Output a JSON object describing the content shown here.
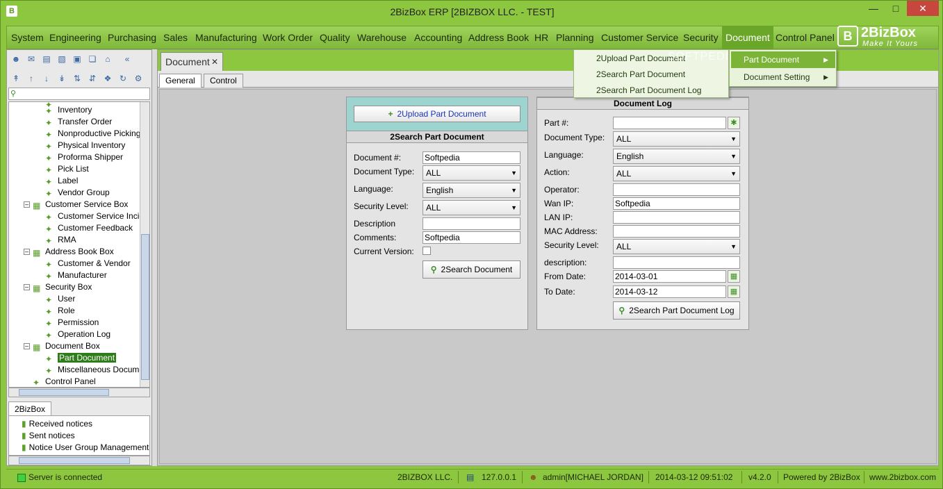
{
  "app": {
    "title": "2BizBox ERP [2BIZBOX LLC. - TEST]",
    "icon_label": "B",
    "minimize": "—",
    "maximize": "□",
    "close": "✕"
  },
  "menu": {
    "items": [
      "System",
      "Engineering",
      "Purchasing",
      "Sales",
      "Manufacturing",
      "Work Order",
      "Quality",
      "Warehouse",
      "Accounting",
      "Address Book",
      "HR",
      "Planning",
      "Customer Service",
      "Security",
      "Document",
      "Control Panel"
    ],
    "active": "Document"
  },
  "logo": {
    "name": "2BizBox",
    "tagline": "Make It Yours",
    "mark": "B"
  },
  "watermark": "SOFTPEDIA",
  "document_menu": {
    "items": [
      "Part Document",
      "Document Setting"
    ],
    "highlighted": "Part Document"
  },
  "part_document_submenu": {
    "items": [
      "2Upload Part Document",
      "2Search Part Document",
      "2Search Part Document Log"
    ]
  },
  "left_panel": {
    "search_placeholder": "",
    "tree": [
      {
        "label": "Inventory",
        "level": 2
      },
      {
        "label": "Transfer Order",
        "level": 2
      },
      {
        "label": "Nonproductive Picking",
        "level": 2
      },
      {
        "label": "Physical Inventory",
        "level": 2
      },
      {
        "label": "Proforma Shipper",
        "level": 2
      },
      {
        "label": "Pick List",
        "level": 2
      },
      {
        "label": "Label",
        "level": 2
      },
      {
        "label": "Vendor Group",
        "level": 2
      },
      {
        "label": "Customer Service Box",
        "level": 1
      },
      {
        "label": "Customer Service Incident",
        "level": 2
      },
      {
        "label": "Customer Feedback",
        "level": 2
      },
      {
        "label": "RMA",
        "level": 2
      },
      {
        "label": "Address Book Box",
        "level": 1
      },
      {
        "label": "Customer & Vendor",
        "level": 2
      },
      {
        "label": "Manufacturer",
        "level": 2
      },
      {
        "label": "Security Box",
        "level": 1
      },
      {
        "label": "User",
        "level": 2
      },
      {
        "label": "Role",
        "level": 2
      },
      {
        "label": "Permission",
        "level": 2
      },
      {
        "label": "Operation Log",
        "level": 2
      },
      {
        "label": "Document Box",
        "level": 1
      },
      {
        "label": "Part Document",
        "level": 2,
        "selected": true
      },
      {
        "label": "Miscellaneous Document",
        "level": 2
      },
      {
        "label": "Control Panel",
        "level": 1
      }
    ],
    "bottom_tab": "2BizBox",
    "notices": [
      "Received notices",
      "Sent notices",
      "Notice User Group Management"
    ]
  },
  "main": {
    "doc_tab": "Document",
    "doc_tab_close": "✕",
    "subtabs": [
      "General",
      "Control"
    ],
    "active_subtab": "General",
    "upload_button": "2Upload Part Document",
    "search_panel": {
      "header": "2Search Part Document",
      "labels": {
        "document_no": "Document #:",
        "document_type": "Document Type:",
        "language": "Language:",
        "security_level": "Security Level:",
        "description": "Description",
        "comments": "Comments:",
        "current_version": "Current Version:"
      },
      "values": {
        "document_no": "Softpedia",
        "document_type": "ALL",
        "language": "English",
        "security_level": "ALL",
        "description": "",
        "comments": "Softpedia",
        "current_version": false
      },
      "search_button": "2Search Document"
    },
    "log_panel": {
      "header": "Document Log",
      "labels": {
        "part_no": "Part #:",
        "document_type": "Document Type:",
        "language": "Language:",
        "action": "Action:",
        "operator": "Operator:",
        "wan_ip": "Wan IP:",
        "lan_ip": "LAN IP:",
        "mac": "MAC Address:",
        "security_level": "Security Level:",
        "description": "description:",
        "from_date": "From Date:",
        "to_date": "To Date:"
      },
      "values": {
        "part_no": "",
        "document_type": "ALL",
        "language": "English",
        "action": "ALL",
        "operator": "",
        "wan_ip": "Softpedia",
        "lan_ip": "",
        "mac": "",
        "security_level": "ALL",
        "description": "",
        "from_date": "2014-03-01",
        "to_date": "2014-03-12"
      },
      "search_button": "2Search Part Document Log"
    }
  },
  "status": {
    "connection": "Server is connected",
    "company": "2BIZBOX LLC.",
    "ip": "127.0.0.1",
    "user": "admin[MICHAEL JORDAN]",
    "datetime": "2014-03-12 09:51:02",
    "version": "v4.2.0",
    "powered": "Powered by 2BizBox",
    "site": "www.2bizbox.com"
  },
  "colors": {
    "accent": "#8dc63f",
    "menu_active": "#6aa728",
    "selection": "#2e7d1a",
    "upload_band": "#9dd4cf"
  }
}
